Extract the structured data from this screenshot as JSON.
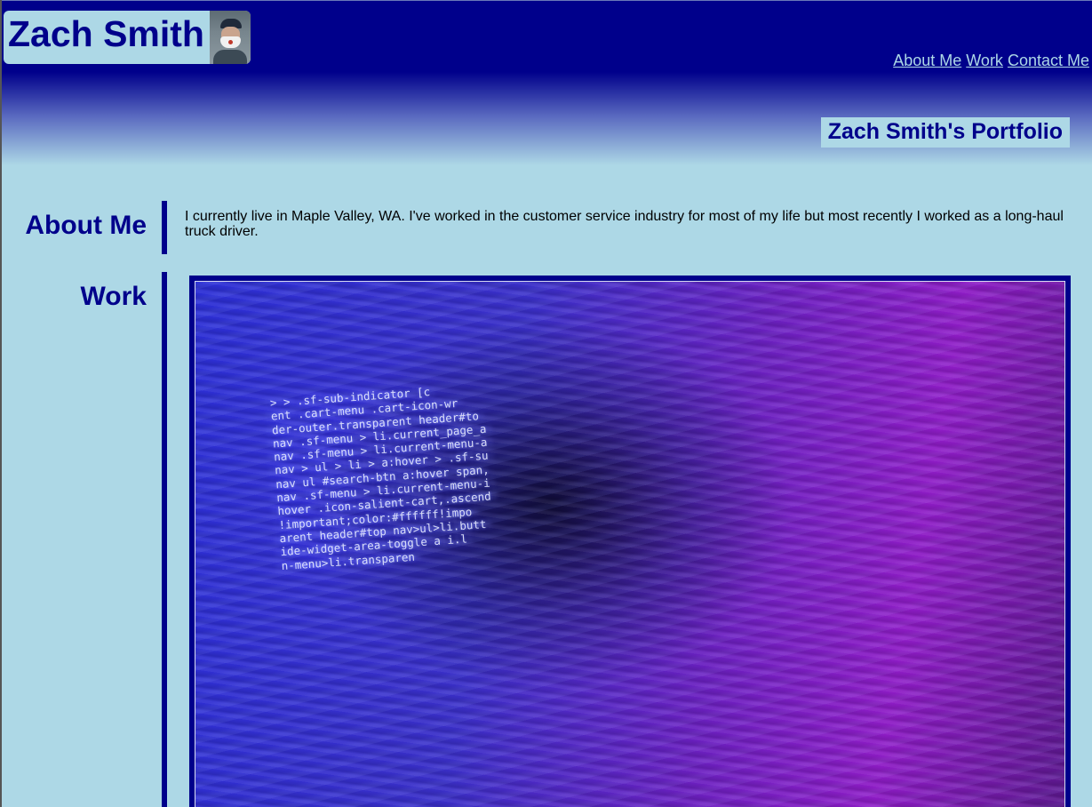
{
  "header": {
    "brand_name": "Zach Smith",
    "avatar_icon": "profile-photo",
    "nav": {
      "about": "About Me",
      "work": "Work",
      "contact": "Contact Me"
    },
    "portfolio_title": "Zach Smith's Portfolio"
  },
  "about": {
    "heading": "About Me",
    "text": "I currently live in Maple Valley, WA. I've worked in the customer service industry for most of my life but most recently I worked as a long-haul truck driver."
  },
  "work": {
    "heading": "Work",
    "image_code_lines": [
      "> > .sf-sub-indicator [c",
      "ent .cart-menu .cart-icon-wr",
      "der-outer.transparent header#to",
      "nav .sf-menu > li.current_page_a",
      "nav .sf-menu > li.current-menu-a",
      "nav > ul > li > a:hover > .sf-su",
      "nav ul #search-btn a:hover span,",
      "nav .sf-menu > li.current-menu-i",
      "hover .icon-salient-cart,.ascend",
      "!important;color:#ffffff!impo",
      "arent header#top nav>ul>li.butt",
      "ide-widget-area-toggle a i.l",
      "n-menu>li.transparen"
    ]
  },
  "colors": {
    "primary": "#00008b",
    "background": "#add8e6"
  }
}
